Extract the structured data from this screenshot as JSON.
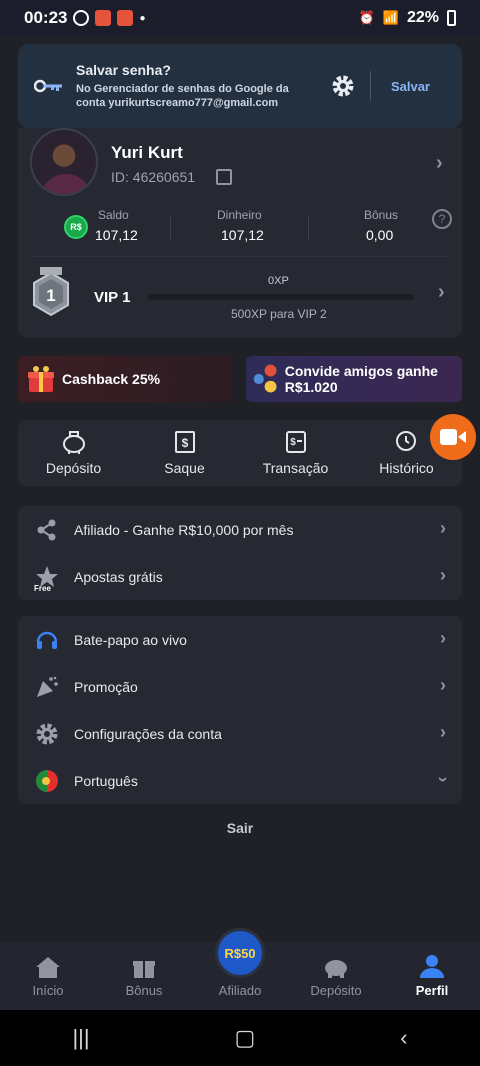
{
  "status_bar": {
    "time": "00:23",
    "battery": "22%"
  },
  "password_prompt": {
    "title": "Salvar senha?",
    "description": "No Gerenciador de senhas do Google da conta yurikurtscreamo777@gmail.com",
    "save_label": "Salvar"
  },
  "profile": {
    "name": "Yuri Kurt",
    "id": "ID: 46260651"
  },
  "balances": [
    {
      "label": "Saldo",
      "value": "107,12"
    },
    {
      "label": "Dinheiro",
      "value": "107,12"
    },
    {
      "label": "Bônus",
      "value": "0,00"
    }
  ],
  "currency_badge": "R$",
  "vip": {
    "level_label": "VIP 1",
    "badge_number": "1",
    "xp": "0XP",
    "next": "500XP para VIP 2",
    "progress_fraction": 0.0
  },
  "promos": {
    "cashback": "Cashback 25%",
    "invite": "Convide amigos ganhe R$1.020"
  },
  "actions": [
    "Depósito",
    "Saque",
    "Transação",
    "Histórico"
  ],
  "menu1": [
    "Afiliado - Ganhe R$10,000 por mês",
    "Apostas grátis"
  ],
  "menu2": [
    "Bate-papo ao vivo",
    "Promoção",
    "Configurações da conta",
    "Português"
  ],
  "free_badge": "Free",
  "logout": "Sair",
  "bottom_nav": {
    "items": [
      "Início",
      "Bônus",
      "Afiliado",
      "Depósito",
      "Perfil"
    ],
    "center_badge": "R$50",
    "active": "Perfil"
  },
  "colors": {
    "accent": "#1f58c7",
    "vip_bar": "#f5c242",
    "fab": "#ef6c1a",
    "rs_green": "#19a84a"
  }
}
